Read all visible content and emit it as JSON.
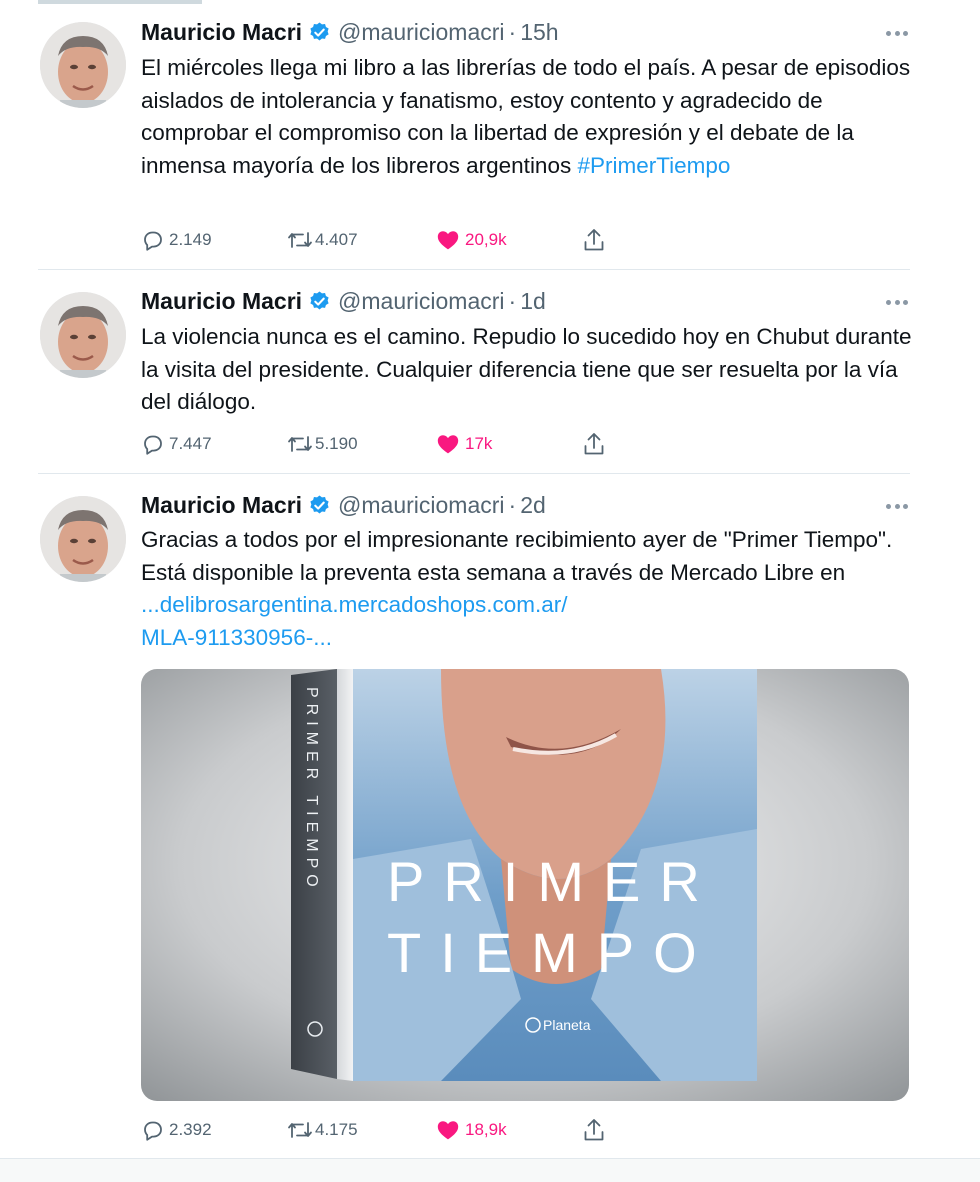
{
  "tweets": [
    {
      "author": "Mauricio Macri",
      "handle": "@mauriciomacri",
      "separator": "·",
      "time": "15h",
      "text_plain": "El miércoles llega mi libro a las librerías de todo el país. A pesar de episodios aislados de intolerancia y fanatismo, estoy contento y agradecido de comprobar el compromiso con la libertad de expresión y el debate de la inmensa mayoría de los libreros argentinos ",
      "hashtag": "#PrimerTiempo",
      "replies": "2.149",
      "retweets": "4.407",
      "likes": "20,9k"
    },
    {
      "author": "Mauricio Macri",
      "handle": "@mauriciomacri",
      "separator": "·",
      "time": "1d",
      "text_plain": "La violencia nunca es el camino. Repudio lo sucedido hoy en Chubut durante la visita del presidente. Cualquier diferencia tiene que ser resuelta por la vía del diálogo.",
      "replies": "7.447",
      "retweets": "5.190",
      "likes": "17k"
    },
    {
      "author": "Mauricio Macri",
      "handle": "@mauriciomacri",
      "separator": "·",
      "time": "2d",
      "text_plain": "Gracias a todos por el impresionante recibimiento ayer de \"Primer Tiempo\".  Está disponible la preventa esta semana a través de Mercado Libre en ",
      "link": "...delibrosargentina.mercadoshops.com.ar/ MLA-911330956-...",
      "replies": "2.392",
      "retweets": "4.175",
      "likes": "18,9k",
      "media": {
        "spine_title": "PRIMER TIEMPO",
        "cover_line1": "PRIMER",
        "cover_line2": "TIEMPO",
        "publisher": "Planeta"
      }
    }
  ],
  "colors": {
    "link": "#1d9bf0",
    "like": "#f91880",
    "muted": "#536471",
    "verified": "#1d9bf0"
  },
  "icons": [
    "verified-badge-icon",
    "more-options-icon",
    "reply-icon",
    "retweet-icon",
    "like-heart-icon",
    "share-icon"
  ]
}
